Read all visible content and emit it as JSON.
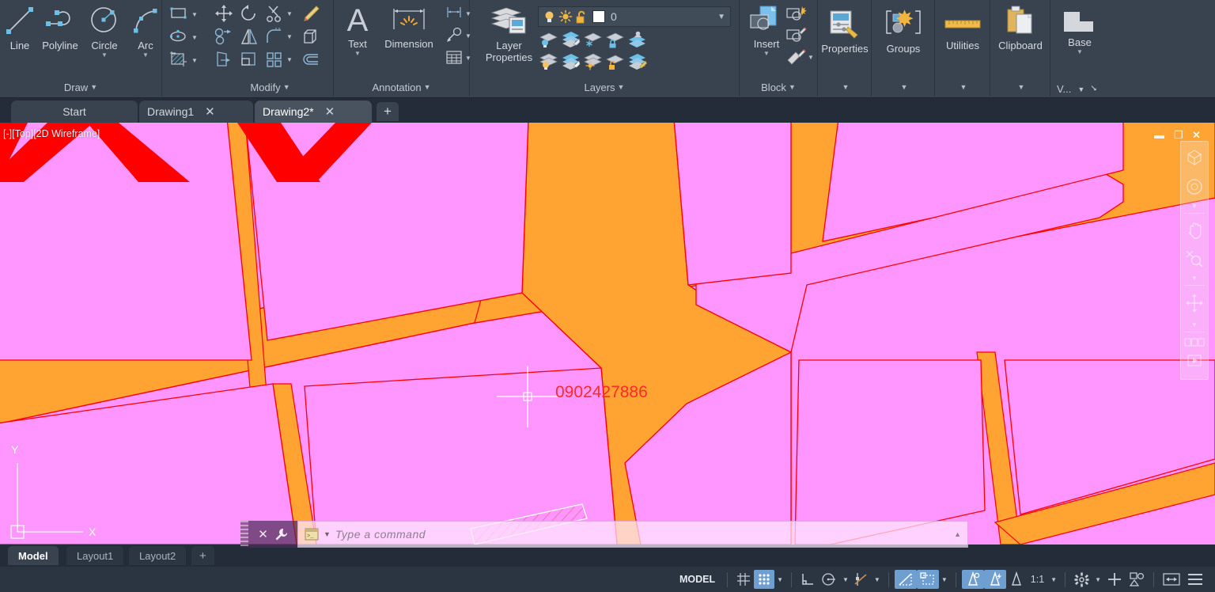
{
  "app": {
    "theme_bg": "#39434f",
    "canvas_bg": "#ff96ff"
  },
  "ribbon": {
    "panels": [
      {
        "name": "draw",
        "title": "Draw"
      },
      {
        "name": "modify",
        "title": "Modify"
      },
      {
        "name": "annotation",
        "title": "Annotation"
      },
      {
        "name": "layers",
        "title": "Layers"
      },
      {
        "name": "block",
        "title": "Block"
      },
      {
        "name": "properties",
        "title": ""
      },
      {
        "name": "groups",
        "title": ""
      },
      {
        "name": "utilities",
        "title": ""
      },
      {
        "name": "clipboard",
        "title": ""
      },
      {
        "name": "view",
        "title": ""
      }
    ],
    "draw": {
      "line": "Line",
      "polyline": "Polyline",
      "circle": "Circle",
      "arc": "Arc",
      "title": "Draw"
    },
    "modify": {
      "title": "Modify"
    },
    "annotation": {
      "text": "Text",
      "dimension": "Dimension",
      "title": "Annotation"
    },
    "layers": {
      "layer_properties": "Layer\nProperties",
      "layer_properties_l1": "Layer",
      "layer_properties_l2": "Properties",
      "current_layer": "0",
      "title": "Layers"
    },
    "block": {
      "insert": "Insert",
      "title": "Block"
    },
    "properties": {
      "label": "Properties"
    },
    "groups": {
      "label": "Groups"
    },
    "utilities": {
      "label": "Utilities"
    },
    "clipboard": {
      "label": "Clipboard"
    },
    "view": {
      "base": "Base",
      "more": "V..."
    }
  },
  "file_tabs": {
    "items": [
      {
        "label": "Start",
        "active": false,
        "closable": false
      },
      {
        "label": "Drawing1",
        "active": false,
        "closable": true
      },
      {
        "label": "Drawing2*",
        "active": true,
        "closable": true
      }
    ],
    "new_tab": "+"
  },
  "viewport": {
    "label": "[-][Top][2D Wireframe]",
    "ucs_x": "X",
    "ucs_y": "Y",
    "window_controls": {
      "minimize": "minimize-icon",
      "restore": "restore-icon",
      "close": "close-icon"
    }
  },
  "drawing": {
    "text_annotation": "0902427886",
    "text_color": "#ff0000",
    "parcel_fill": "#ff96ff",
    "road_fill": "#ffa333",
    "outline_color": "#ff0000",
    "hatch_outline": "#ffffff",
    "hatch_line_color": "#dd5577",
    "red_text_blobs": "A/V",
    "navbar_items": [
      "viewcube-icon",
      "orbit-icon",
      "pan-icon",
      "zoom-icon",
      "orbit-3d-icon",
      "showmotion-icon"
    ]
  },
  "command_line": {
    "placeholder": "Type a command",
    "close_icon": "close-icon",
    "customize_icon": "wrench-icon",
    "history_icon": "command-history-icon",
    "scroll_icon": "scroll-up-icon"
  },
  "layout_tabs": {
    "items": [
      {
        "label": "Model",
        "active": true
      },
      {
        "label": "Layout1",
        "active": false
      },
      {
        "label": "Layout2",
        "active": false
      }
    ],
    "add": "+"
  },
  "status_bar": {
    "model_label": "MODEL",
    "scale": "1:1",
    "items": [
      {
        "name": "grid-display",
        "icon": "grid-icon",
        "on": false
      },
      {
        "name": "snap-mode",
        "icon": "snap-icon",
        "on": true
      },
      {
        "name": "ortho-mode",
        "icon": "ortho-icon",
        "on": false
      },
      {
        "name": "polar-tracking",
        "icon": "polar-icon",
        "on": false
      },
      {
        "name": "object-snap",
        "icon": "osnap-icon",
        "on": false
      },
      {
        "name": "object-snap-tracking",
        "icon": "otrack-icon",
        "on": true
      },
      {
        "name": "dynamic-ucs",
        "icon": "ducs-icon",
        "on": true
      },
      {
        "name": "dynamic-input",
        "icon": "dyn-icon",
        "on": true
      },
      {
        "name": "lineweight",
        "icon": "lineweight-icon",
        "on": true
      },
      {
        "name": "transparency",
        "icon": "transparency-icon",
        "on": false
      },
      {
        "name": "annotation-visibility",
        "icon": "annotation-icon",
        "on": false
      },
      {
        "name": "workspace-settings",
        "icon": "gear-icon",
        "on": false
      },
      {
        "name": "isolate-objects",
        "icon": "plus-icon",
        "on": false
      },
      {
        "name": "hardware-acceleration",
        "icon": "shapes-icon",
        "on": false
      },
      {
        "name": "clean-screen",
        "icon": "fullscreen-icon",
        "on": false
      },
      {
        "name": "customization",
        "icon": "hamburger-icon",
        "on": false
      }
    ]
  }
}
